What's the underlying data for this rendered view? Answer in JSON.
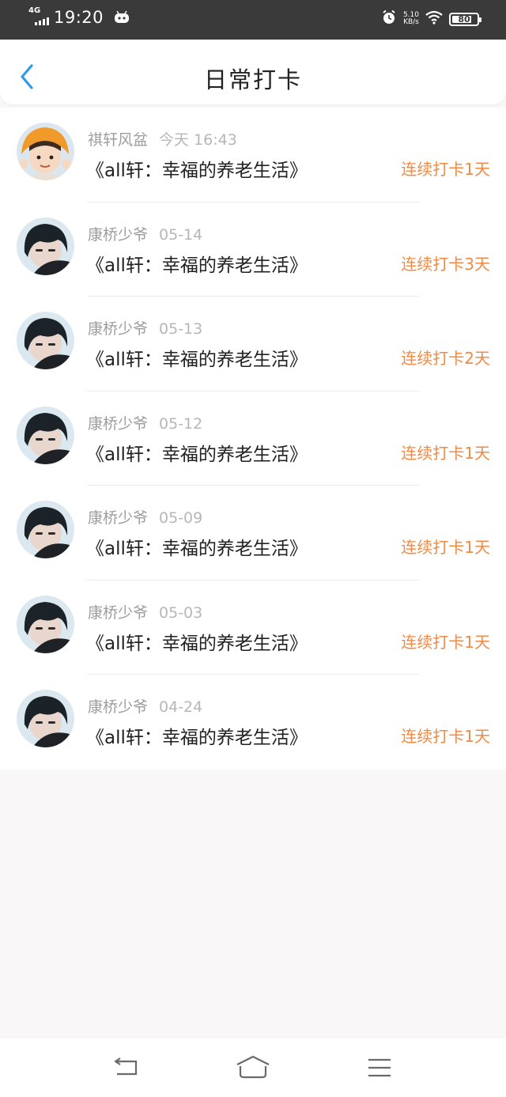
{
  "status_bar": {
    "network": "4G",
    "time": "19:20",
    "speed_value": "5.10",
    "speed_unit": "KB/s",
    "battery": "80",
    "battery_level": 0.8
  },
  "header": {
    "title": "日常打卡",
    "back_icon": "back-chevron-icon"
  },
  "colors": {
    "accent": "#2f9be8",
    "streak": "#f08a44",
    "status_bar_bg": "#3a3a3a",
    "page_bg": "#f9f7f7"
  },
  "checkins": [
    {
      "user": "祺轩风盆",
      "date": "今天 16:43",
      "book": "《all轩：幸福的养老生活》",
      "streak": "连续打卡1天",
      "avatar": "orange-hat-avatar"
    },
    {
      "user": "康桥少爷",
      "date": "05-14",
      "book": "《all轩：幸福的养老生活》",
      "streak": "连续打卡3天",
      "avatar": "dark-hair-avatar"
    },
    {
      "user": "康桥少爷",
      "date": "05-13",
      "book": "《all轩：幸福的养老生活》",
      "streak": "连续打卡2天",
      "avatar": "dark-hair-avatar"
    },
    {
      "user": "康桥少爷",
      "date": "05-12",
      "book": "《all轩：幸福的养老生活》",
      "streak": "连续打卡1天",
      "avatar": "dark-hair-avatar"
    },
    {
      "user": "康桥少爷",
      "date": "05-09",
      "book": "《all轩：幸福的养老生活》",
      "streak": "连续打卡1天",
      "avatar": "dark-hair-avatar"
    },
    {
      "user": "康桥少爷",
      "date": "05-03",
      "book": "《all轩：幸福的养老生活》",
      "streak": "连续打卡1天",
      "avatar": "dark-hair-avatar"
    },
    {
      "user": "康桥少爷",
      "date": "04-24",
      "book": "《all轩：幸福的养老生活》",
      "streak": "连续打卡1天",
      "avatar": "dark-hair-avatar"
    }
  ],
  "nav": {
    "back_icon": "nav-back-icon",
    "home_icon": "nav-home-icon",
    "menu_icon": "nav-menu-icon"
  }
}
